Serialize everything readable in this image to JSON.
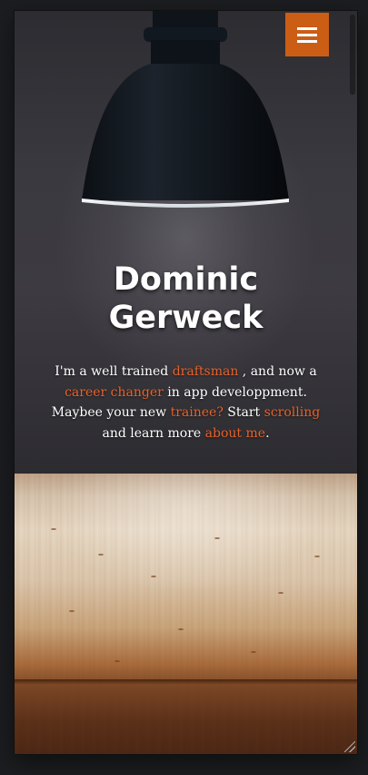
{
  "hero": {
    "title_line1": "Dominic",
    "title_line2": "Gerweck"
  },
  "intro": {
    "p1": "I'm a well trained ",
    "link_draftsman": "draftsman",
    "p2": " , and now a ",
    "link_career_changer": "career changer",
    "p3": " in app developpment. Maybee your new ",
    "link_trainee": "trainee?",
    "p4": " Start ",
    "link_scrolling": "scrolling",
    "p5": " and learn more ",
    "link_about_me": "about me",
    "p6": "."
  },
  "menu": {
    "icon": "hamburger-menu-icon"
  },
  "colors": {
    "accent": "#cc5d15",
    "link": "#e8622a",
    "text": "#ffffff"
  }
}
